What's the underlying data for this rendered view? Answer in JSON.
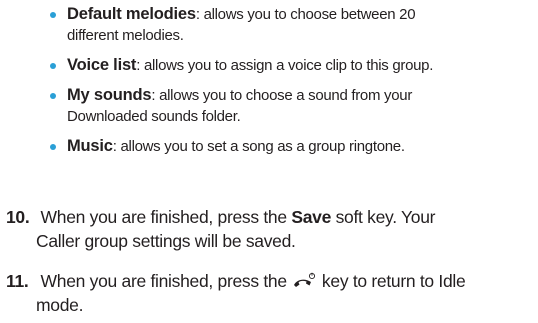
{
  "bullets": [
    {
      "term": "Default melodies",
      "text_line1": ": allows you to choose between 20",
      "text_line2": "different melodies."
    },
    {
      "term": "Voice list",
      "text_line1": ": allows you to assign a voice clip to this group.",
      "text_line2": ""
    },
    {
      "term": "My sounds",
      "text_line1": ": allows you to choose a sound from your",
      "text_line2": "Downloaded sounds folder."
    },
    {
      "term": "Music",
      "text_line1": ": allows you to set a song as a group ringtone.",
      "text_line2": ""
    }
  ],
  "steps": [
    {
      "number": "10.",
      "text_before": " When you are finished, press the ",
      "key": "Save",
      "text_after": " soft key. Your",
      "line2": "Caller group settings will be saved."
    },
    {
      "number": "11.",
      "text_before": " When you are finished, press the ",
      "key_icon": "end-call-power-icon",
      "text_after": " key to return to Idle",
      "line2": "mode."
    }
  ],
  "colors": {
    "bullet": "#2a9fd6",
    "text": "#231f20"
  }
}
